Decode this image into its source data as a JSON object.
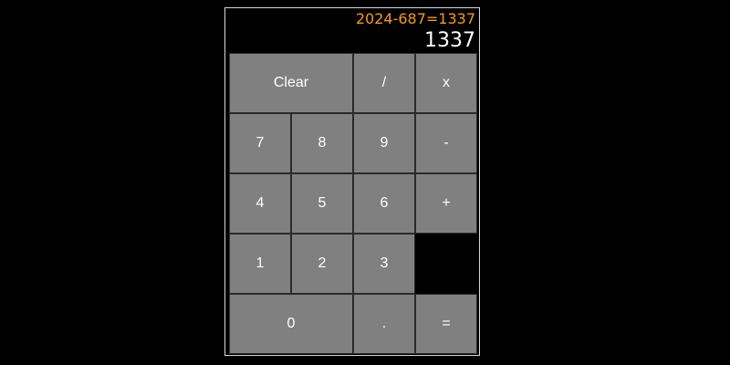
{
  "display": {
    "expression": "2024-687=1337",
    "result": "1337",
    "expression_color": "#f59a1c"
  },
  "keys": {
    "clear": "Clear",
    "divide": "/",
    "multiply": "x",
    "seven": "7",
    "eight": "8",
    "nine": "9",
    "minus": "-",
    "four": "4",
    "five": "5",
    "six": "6",
    "plus": "+",
    "one": "1",
    "two": "2",
    "three": "3",
    "zero": "0",
    "decimal": ".",
    "equals": "="
  },
  "colors": {
    "key_background": "#808080",
    "background": "#000000",
    "text": "#ffffff"
  }
}
